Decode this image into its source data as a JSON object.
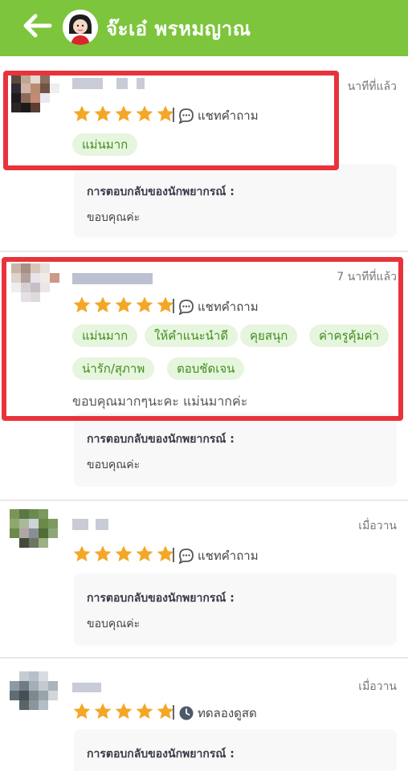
{
  "header": {
    "title": "จ๊ะเอ๋ พรหมญาณ",
    "back_icon": "arrow-left-icon",
    "bg_color": "#7cc53c"
  },
  "reply_title": "การตอบกลับของนักพยากรณ์ :",
  "reviews": [
    {
      "time": "นาทีที่แล้ว",
      "rating": 5,
      "channel": "แชทคำถาม",
      "channel_icon": "chat-bubble-icon",
      "tags": [
        "แม่นมาก"
      ],
      "comment": "",
      "reply": "ขอบคุณค่ะ"
    },
    {
      "time": "7 นาทีที่แล้ว",
      "rating": 5,
      "channel": "แชทคำถาม",
      "channel_icon": "chat-bubble-icon",
      "tags": [
        "แม่นมาก",
        "ให้คำแนะนำดี",
        "คุยสนุก",
        "ค่าครูคุ้มค่า",
        "น่ารัก/สุภาพ",
        "ตอบชัดเจน"
      ],
      "comment": "ขอบคุณมากๆนะคะ แม่นมากค่ะ",
      "reply": "ขอบคุณค่ะ"
    },
    {
      "time": "เมื่อวาน",
      "rating": 5,
      "channel": "แชทคำถาม",
      "channel_icon": "chat-bubble-icon",
      "tags": [],
      "comment": "",
      "reply": "ขอบคุณค่ะ"
    },
    {
      "time": "เมื่อวาน",
      "rating": 5,
      "channel": "ทดลองดูสด",
      "channel_icon": "clock-icon",
      "tags": [],
      "comment": "",
      "reply": ""
    }
  ],
  "colors": {
    "star": "#f4a726",
    "tag_bg": "#e6f5dd",
    "tag_text": "#3f8f1e",
    "highlight": "#e8333b"
  }
}
